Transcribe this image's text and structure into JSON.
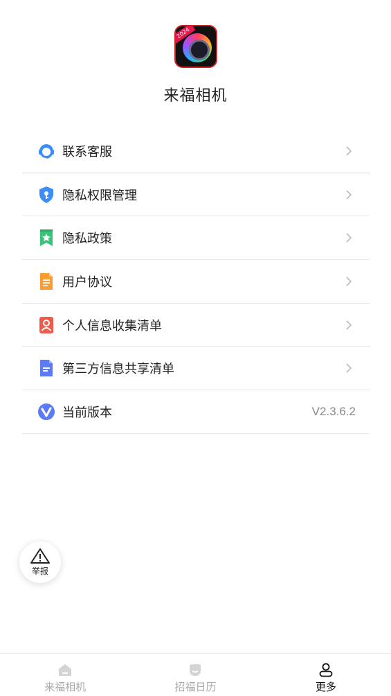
{
  "app": {
    "name": "来福相机",
    "logo_badge": "2024"
  },
  "menu": {
    "items": [
      {
        "label": "联系客服",
        "icon": "customer-service-icon"
      },
      {
        "label": "隐私权限管理",
        "icon": "shield-icon"
      },
      {
        "label": "隐私政策",
        "icon": "bookmark-star-icon"
      },
      {
        "label": "用户协议",
        "icon": "document-icon"
      },
      {
        "label": "个人信息收集清单",
        "icon": "person-card-icon"
      },
      {
        "label": "第三方信息共享清单",
        "icon": "list-document-icon"
      },
      {
        "label": "当前版本",
        "icon": "version-v-icon",
        "value": "V2.3.6.2"
      }
    ]
  },
  "report": {
    "label": "举报",
    "icon": "warning-icon"
  },
  "tabbar": {
    "tabs": [
      {
        "label": "来福相机",
        "icon": "home-icon",
        "active": false
      },
      {
        "label": "招福日历",
        "icon": "calendar-icon",
        "active": false
      },
      {
        "label": "更多",
        "icon": "user-icon",
        "active": true
      }
    ]
  },
  "colors": {
    "accent_blue": "#3a8ef6",
    "green": "#39c47a",
    "orange": "#ff9a2e",
    "red": "#f05a4a",
    "indigo": "#5b7cf6"
  }
}
